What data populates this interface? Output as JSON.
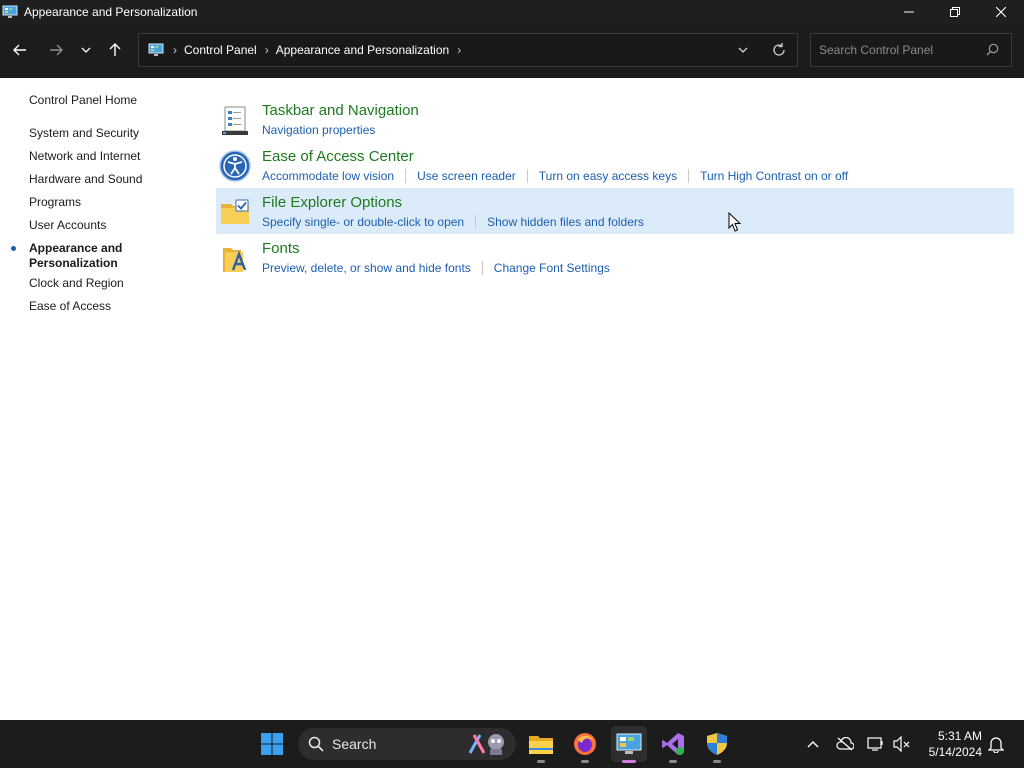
{
  "window": {
    "title": "Appearance and Personalization"
  },
  "address_bar": {
    "breadcrumbs": [
      "Control Panel",
      "Appearance and Personalization"
    ]
  },
  "search": {
    "placeholder": "Search Control Panel"
  },
  "sidebar": {
    "home": "Control Panel Home",
    "items": [
      {
        "label": "System and Security"
      },
      {
        "label": "Network and Internet"
      },
      {
        "label": "Hardware and Sound"
      },
      {
        "label": "Programs"
      },
      {
        "label": "User Accounts"
      },
      {
        "label": "Appearance and Personalization",
        "line1": "Appearance and",
        "line2": "Personalization",
        "active": true
      },
      {
        "label": "Clock and Region"
      },
      {
        "label": "Ease of Access"
      }
    ]
  },
  "categories": [
    {
      "title": "Taskbar and Navigation",
      "icon": "taskbar-icon",
      "links": [
        "Navigation properties"
      ]
    },
    {
      "title": "Ease of Access Center",
      "icon": "ease-of-access-icon",
      "links": [
        "Accommodate low vision",
        "Use screen reader",
        "Turn on easy access keys",
        "Turn High Contrast on or off"
      ]
    },
    {
      "title": "File Explorer Options",
      "icon": "folder-options-icon",
      "links": [
        "Specify single- or double-click to open",
        "Show hidden files and folders"
      ]
    },
    {
      "title": "Fonts",
      "icon": "fonts-icon",
      "links": [
        "Preview, delete, or show and hide fonts",
        "Change Font Settings"
      ]
    }
  ],
  "taskbar": {
    "search_label": "Search",
    "clock_time": "5:31 AM",
    "clock_date": "5/14/2024"
  },
  "colors": {
    "category_title": "#1e7a1e",
    "link": "#1c5fb0",
    "hover_row": "#dcebf9",
    "titlebar": "#1f1f1f"
  }
}
